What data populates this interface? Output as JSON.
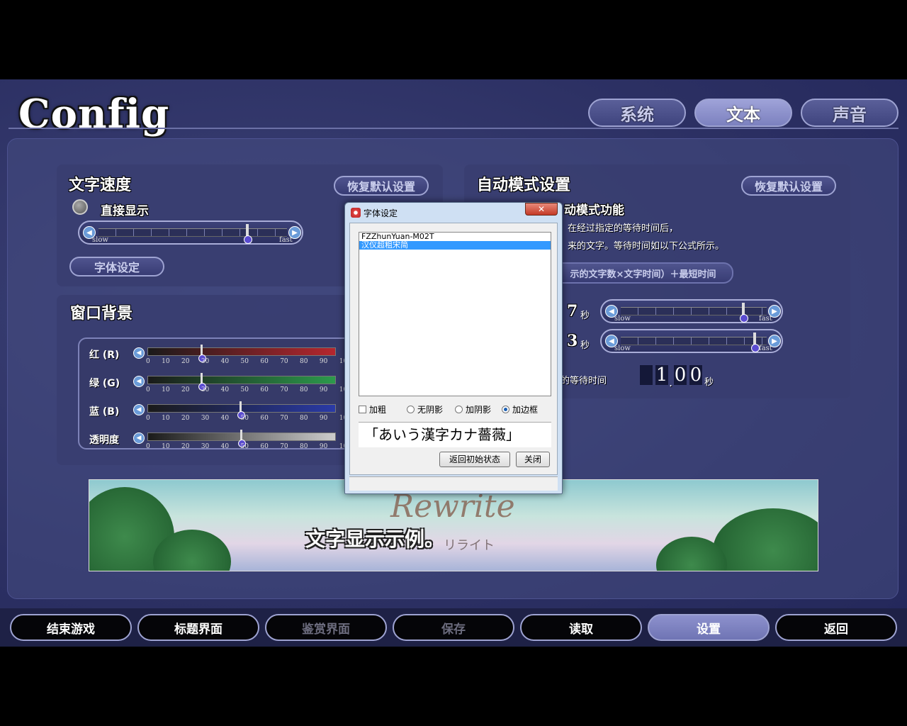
{
  "app": {
    "title": "Config"
  },
  "tabs": [
    {
      "label": "系统",
      "active": false
    },
    {
      "label": "文本",
      "active": true
    },
    {
      "label": "声音",
      "active": false
    }
  ],
  "text_speed": {
    "title": "文字速度",
    "reset_label": "恢复默认设置",
    "instant_label": "直接显示",
    "slider": {
      "slow": "slow",
      "fast": "fast",
      "value": 0.78
    },
    "font_button": "字体设定"
  },
  "window_bg": {
    "title": "窗口背景",
    "rows": [
      {
        "label": "红 (R)",
        "color": "#b5262e",
        "value": 28
      },
      {
        "label": "绿 (G)",
        "color": "#2c9a4c",
        "value": 28
      },
      {
        "label": "蓝 (B)",
        "color": "#2a3aa6",
        "value": 50
      },
      {
        "label": "透明度",
        "color": "#cccccc",
        "value": 50
      }
    ],
    "ticks": [
      "0",
      "10",
      "20",
      "30",
      "40",
      "50",
      "60",
      "70",
      "80",
      "90",
      "100"
    ]
  },
  "auto_mode": {
    "title": "自动模式设置",
    "reset_label": "恢复默认设置",
    "feature_label": "动模式功能",
    "desc_line1": "在经过指定的等待时间后，",
    "desc_line2": "来的文字。等待时间如以下公式所示。",
    "formula": "示的文字数×文字时间）＋最短时间",
    "row1_value": "7",
    "row2_value": "3",
    "unit": "秒",
    "slider1": {
      "slow": "slow",
      "fast": "fast",
      "value": 0.9
    },
    "slider2": {
      "slow": "slow",
      "fast": "fast",
      "value": 0.95
    },
    "wait_label": "的等待时间",
    "wait_digits": [
      "1",
      "0",
      "0"
    ],
    "wait_unit": "秒"
  },
  "preview": {
    "sample_text": "文字显示示例。",
    "logo": "Rewrite",
    "logo_sub": "リライト"
  },
  "bottom_nav": [
    {
      "label": "结束游戏",
      "state": "normal"
    },
    {
      "label": "标题界面",
      "state": "normal"
    },
    {
      "label": "鉴赏界面",
      "state": "disabled"
    },
    {
      "label": "保存",
      "state": "disabled"
    },
    {
      "label": "读取",
      "state": "normal"
    },
    {
      "label": "设置",
      "state": "active"
    },
    {
      "label": "返回",
      "state": "normal"
    }
  ],
  "font_dialog": {
    "title": "字体设定",
    "close": "✕",
    "fonts": [
      "FZZhunYuan-M02T",
      "汉仪超粗宋简"
    ],
    "selected_index": 1,
    "bold_label": "加粗",
    "shadow_none": "无阴影",
    "shadow_add": "加阴影",
    "shadow_border": "加边框",
    "shadow_selected": "加边框",
    "preview_text": "「あいう漢字カナ薔薇」",
    "reset_button": "返回初始状态",
    "close_button": "关闭"
  }
}
